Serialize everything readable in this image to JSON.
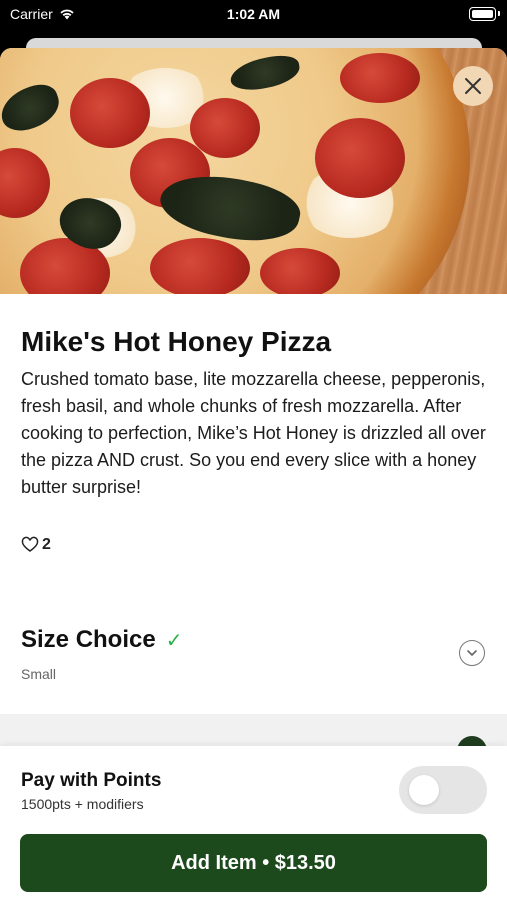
{
  "status_bar": {
    "carrier": "Carrier",
    "time": "1:02 AM"
  },
  "item": {
    "title": "Mike's Hot Honey Pizza",
    "description": "Crushed tomato base, lite mozzarella cheese, pepperonis, fresh basil, and whole chunks of fresh mozzarella. After cooking to perfection, Mike’s Hot Honey is drizzled all over the pizza AND crust. So you end every slice with a honey butter surprise!",
    "likes": "2"
  },
  "size_choice": {
    "title": "Size Choice",
    "selected": "Small"
  },
  "pay_with_points": {
    "title": "Pay with Points",
    "subtitle": "1500pts + modifiers",
    "enabled": false
  },
  "add_button": {
    "label": "Add Item • $13.50"
  },
  "colors": {
    "primary": "#1d4a1c",
    "check": "#2bb24c",
    "close_bg": "#f1d7b4"
  }
}
